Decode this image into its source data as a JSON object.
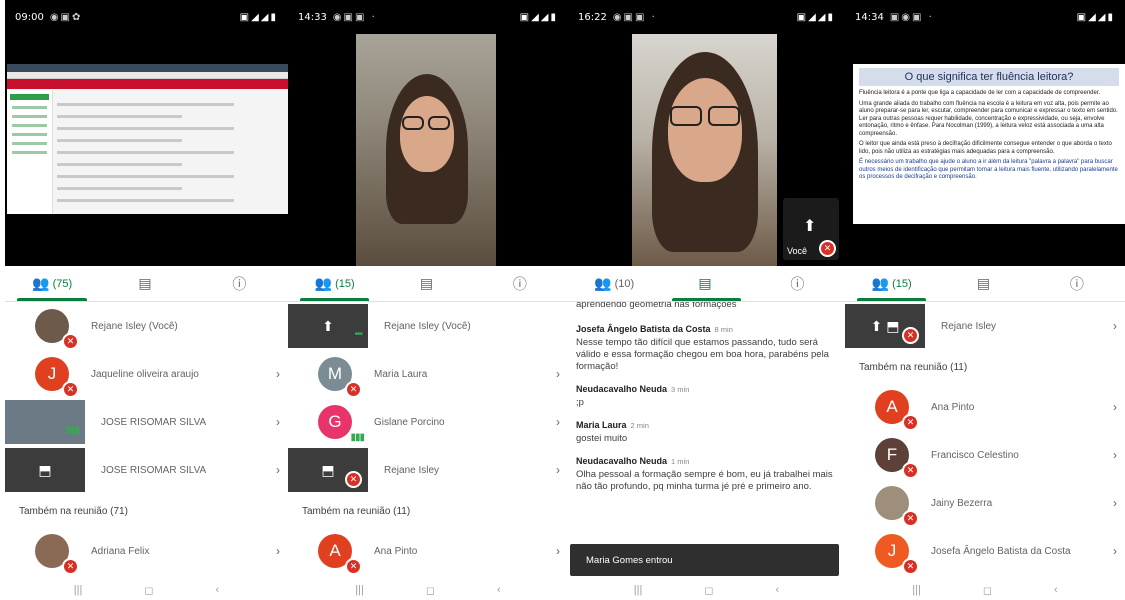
{
  "phones": [
    {
      "status": {
        "time": "09:00"
      },
      "tabs": {
        "people_count": "(75)"
      },
      "people": [
        {
          "name": "Rejane Isley (Você)"
        },
        {
          "name": "Jaqueline oliveira araujo",
          "initial": "J"
        },
        {
          "name": "JOSE RISOMAR SILVA"
        },
        {
          "name": "JOSE RISOMAR SILVA"
        }
      ],
      "section": "Também na reunião (71)",
      "people_after": [
        {
          "name": "Adriana Felix"
        }
      ]
    },
    {
      "status": {
        "time": "14:33"
      },
      "tabs": {
        "people_count": "(15)"
      },
      "people": [
        {
          "name": "Rejane Isley (Você)"
        },
        {
          "name": "Maria Laura",
          "initial": "M"
        },
        {
          "name": "Gislane Porcino",
          "initial": "G"
        },
        {
          "name": "Rejane Isley"
        }
      ],
      "section": "Também na reunião (11)",
      "people_after": [
        {
          "name": "Ana Pinto",
          "initial": "A"
        }
      ]
    },
    {
      "status": {
        "time": "16:22"
      },
      "tabs": {
        "people_count": "(10)"
      },
      "self_label": "Você",
      "chat": {
        "fragment": "aprendendo geometria nas formações",
        "messages": [
          {
            "who": "Josefa Ângelo Batista da Costa",
            "when": "8 min",
            "text": "Nesse tempo tão difícil que estamos passando, tudo será válido e essa formação chegou em boa hora, parabéns pela formação!"
          },
          {
            "who": "Neudacavalho Neuda",
            "when": "3 min",
            "text": ";p"
          },
          {
            "who": "Maria Laura",
            "when": "2 min",
            "text": "gostei muito"
          },
          {
            "who": "Neudacavalho Neuda",
            "when": "1 min",
            "text": "Olha pessoal a formação sempre é bom, eu já trabalhei mais não tão profundo, pq minha turma jé pré e primeiro ano."
          }
        ],
        "toast": "Maria Gomes entrou"
      }
    },
    {
      "status": {
        "time": "14:34"
      },
      "tabs": {
        "people_count": "(15)"
      },
      "slide": {
        "title": "O que significa ter fluência leitora?",
        "bullets": [
          "Fluência leitora é a ponte que liga a capacidade de ler com a capacidade de compreender.",
          "Uma grande aliada do trabalho com fluência na escola é a leitura em voz alta, pois permite ao aluno preparar-se para ler, escutar, compreender para comunicar e expressar o texto em sentido. Ler para outras pessoas requer habilidade, concentração e expressividade, ou seja, envolve entonação, ritmo e ênfase. Para Nocolman (1999), a leitura veloz está associada a uma alta compreensão.",
          "O leitor que ainda está preso à decifração dificilmente consegue entender o que aborda o texto lido, pois não utiliza as estratégias mais adequadas para a compreensão.",
          "É necessário um trabalho que ajude o aluno a ir além da leitura \"palavra a palavra\" para buscar outros meios de identificação que permitam tornar a leitura mais fluente, utilizando paralelamente os processos de decifração e compreensão."
        ]
      },
      "people": [
        {
          "name": "Rejane Isley"
        }
      ],
      "section": "Também na reunião (11)",
      "people_after": [
        {
          "name": "Ana Pinto",
          "initial": "A"
        },
        {
          "name": "Francisco Celestino",
          "initial": "F"
        },
        {
          "name": "Jainy Bezerra"
        },
        {
          "name": "Josefa Ângelo Batista da Costa",
          "initial": "J"
        }
      ]
    }
  ],
  "colors": {
    "accent": "#0a7d3f",
    "mic_off": "#d93025",
    "avatar_red": "#e0401f",
    "avatar_gray": "#7b8c94",
    "avatar_pink": "#e8336b",
    "avatar_brown": "#5d4037"
  },
  "icons": {
    "people": "people-icon",
    "chat": "chat-icon",
    "info": "info-icon",
    "chevron": "chevron-right-icon",
    "mic_off": "mic-off-icon",
    "pin": "pin-icon",
    "present": "present-screen-icon"
  }
}
